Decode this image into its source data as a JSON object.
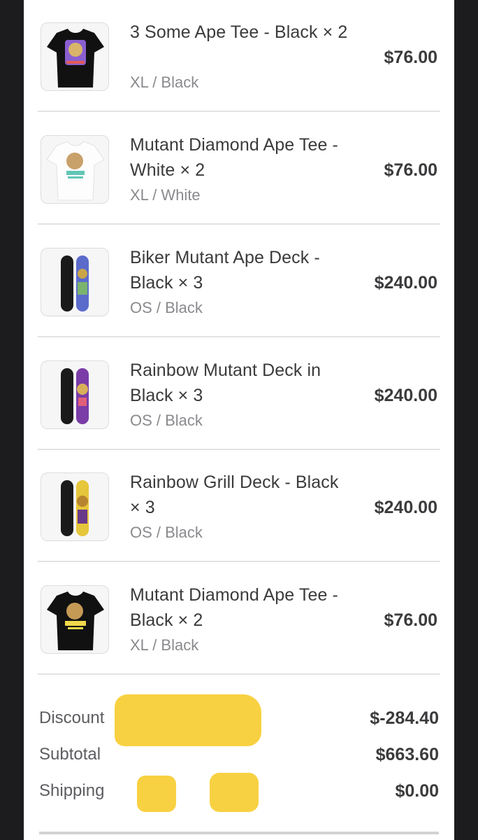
{
  "items": [
    {
      "name": "3 Some Ape Tee - Black × 2",
      "variant": "XL / Black",
      "price": "$76.00",
      "thumb_icon": "black-tshirt-icon",
      "thumb_colors": {
        "bg": "#f6f6f7",
        "garment": "#111111",
        "accent": "#8a5fd0"
      }
    },
    {
      "name": "Mutant Diamond Ape Tee - White × 2",
      "variant": "XL / White",
      "price": "$76.00",
      "thumb_icon": "white-tshirt-icon",
      "thumb_colors": {
        "bg": "#f6f6f7",
        "garment": "#fdfdfd",
        "accent": "#61c6b6"
      }
    },
    {
      "name": "Biker Mutant Ape Deck - Black × 3",
      "variant": "OS / Black",
      "price": "$240.00",
      "thumb_icon": "skate-deck-icon",
      "thumb_colors": {
        "bg": "#f6f6f7",
        "garment": "#1a1a1a",
        "accent": "#5b6bcb"
      }
    },
    {
      "name": "Rainbow Mutant Deck in Black × 3",
      "variant": "OS / Black",
      "price": "$240.00",
      "thumb_icon": "skate-deck-icon",
      "thumb_colors": {
        "bg": "#f6f6f7",
        "garment": "#1a1a1a",
        "accent": "#7a3ca7"
      }
    },
    {
      "name": "Rainbow Grill Deck - Black × 3",
      "variant": "OS / Black",
      "price": "$240.00",
      "thumb_icon": "skate-deck-icon",
      "thumb_colors": {
        "bg": "#f6f6f7",
        "garment": "#1a1a1a",
        "accent": "#e6c63a"
      }
    },
    {
      "name": "Mutant Diamond Ape Tee - Black × 2",
      "variant": "XL / Black",
      "price": "$76.00",
      "thumb_icon": "black-tshirt-icon",
      "thumb_colors": {
        "bg": "#f6f6f7",
        "garment": "#111111",
        "accent": "#f2d84b"
      }
    }
  ],
  "totals": {
    "discount_label": "Discount",
    "discount_value": "$-284.40",
    "subtotal_label": "Subtotal",
    "subtotal_value": "$663.60",
    "shipping_label": "Shipping",
    "shipping_value": "$0.00"
  },
  "colors": {
    "page_bg": "#1c1c1e",
    "sheet_bg": "#ffffff",
    "text": "#3b3b3d",
    "muted": "#8a8a8e",
    "redaction": "#f8cd34"
  }
}
